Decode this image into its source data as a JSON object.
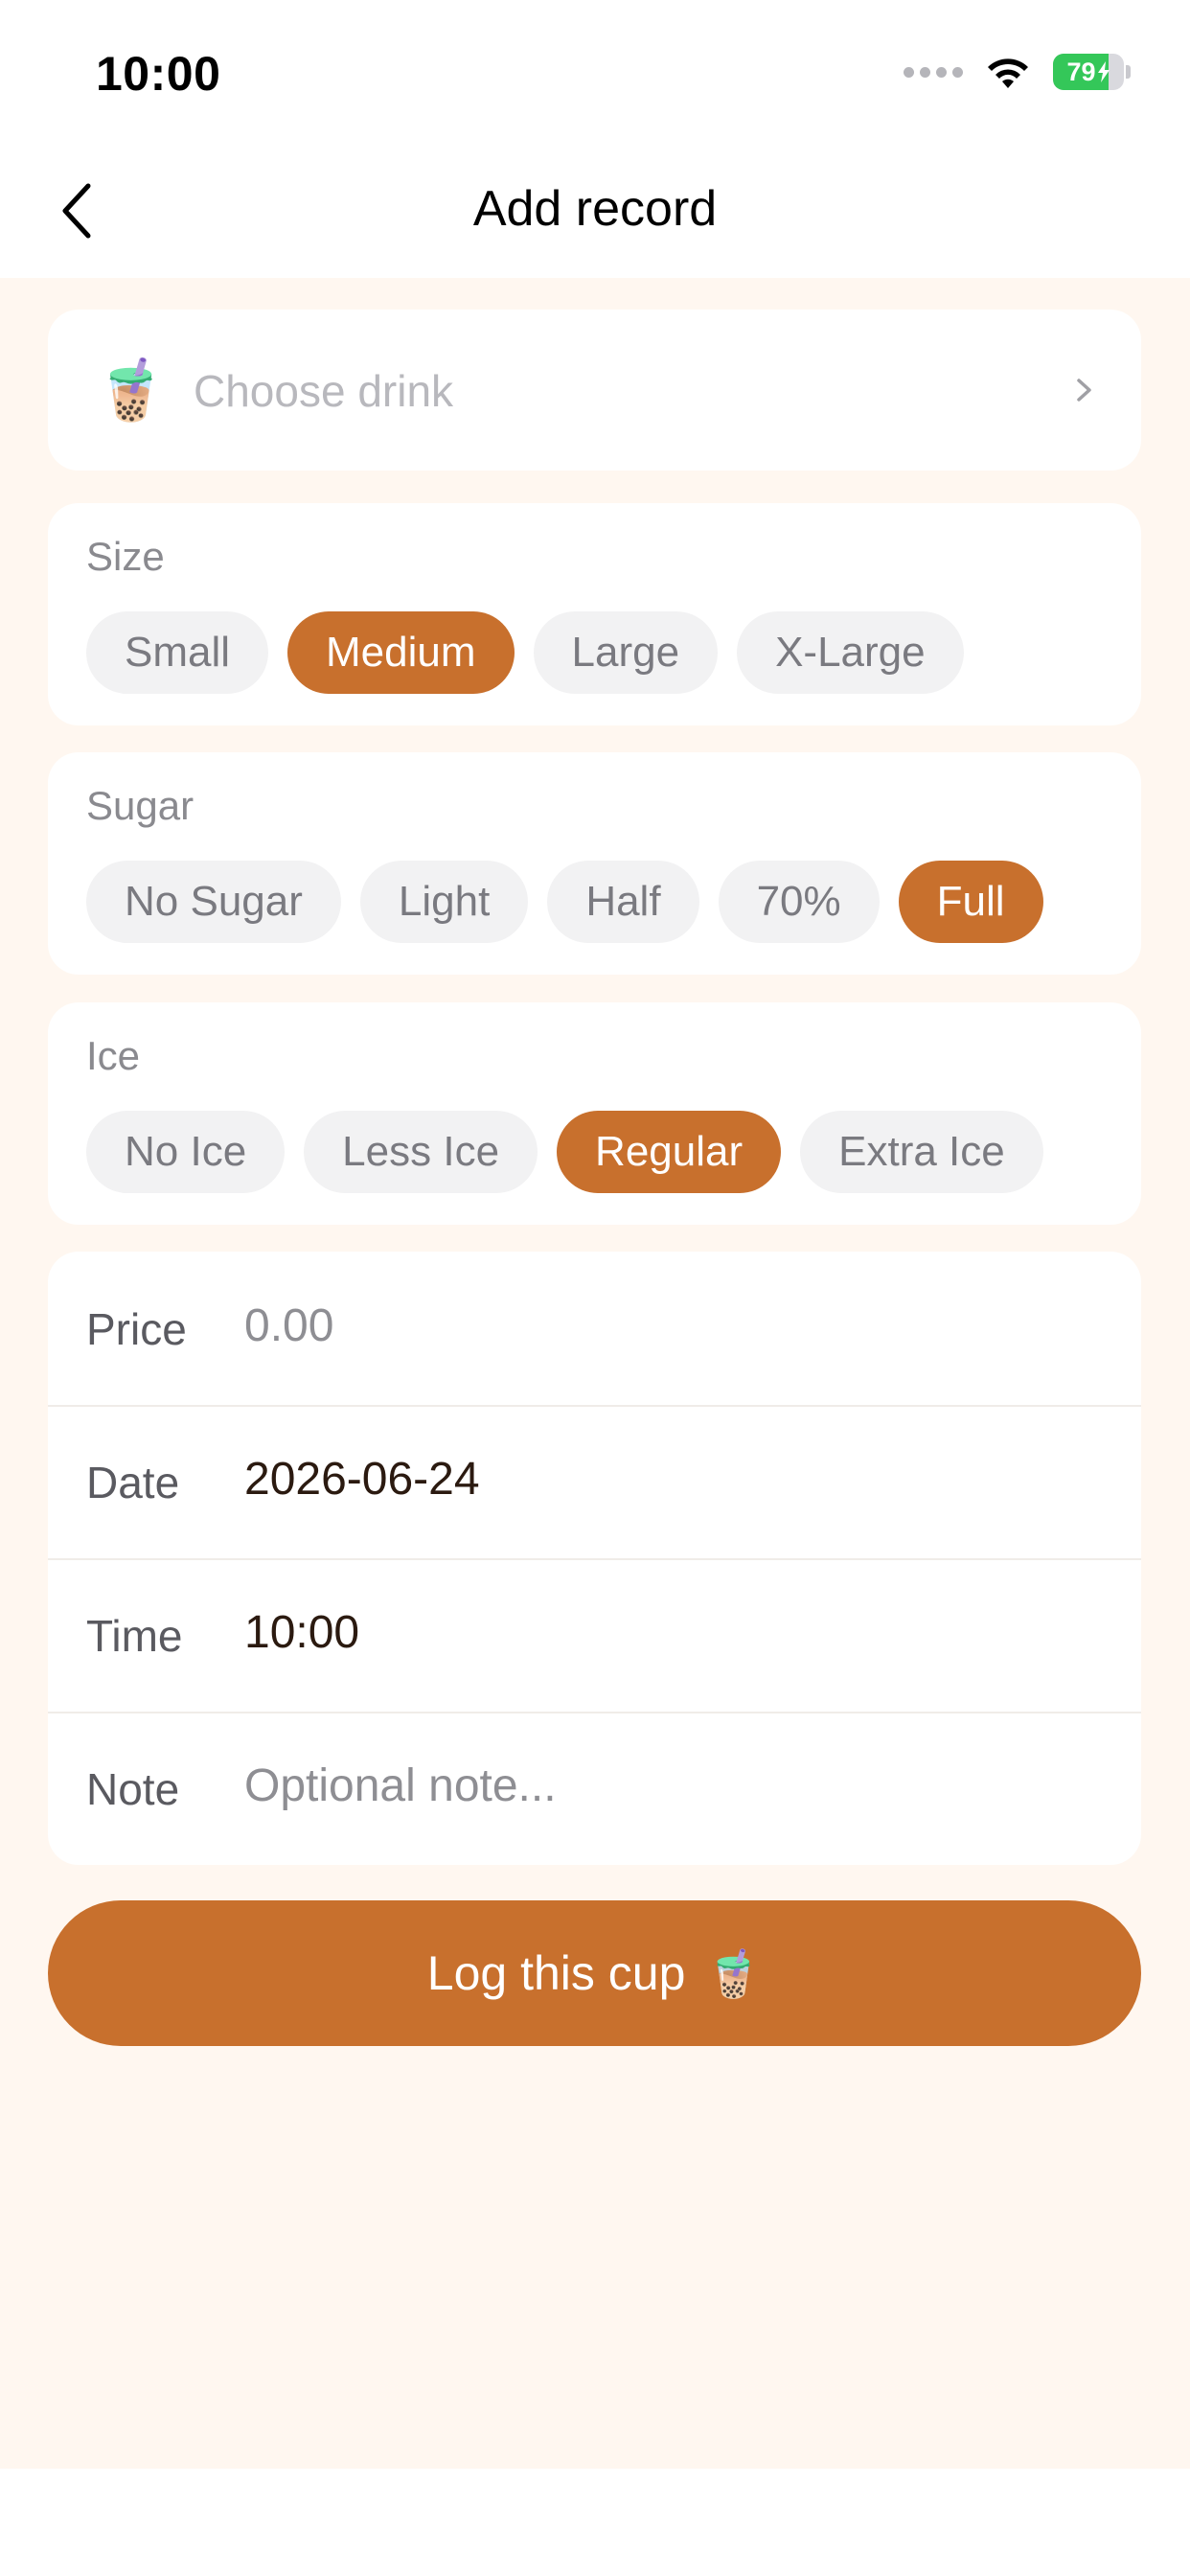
{
  "status_bar": {
    "time": "10:00",
    "battery_percent": 79,
    "battery_label": "79"
  },
  "nav": {
    "title": "Add record",
    "back_icon": "chevron-left-icon"
  },
  "drink": {
    "emoji": "🧋",
    "placeholder": "Choose drink",
    "chevron": "›"
  },
  "size": {
    "label": "Size",
    "options": [
      "Small",
      "Medium",
      "Large",
      "X-Large"
    ],
    "selected": "Medium"
  },
  "sugar": {
    "label": "Sugar",
    "options": [
      "No Sugar",
      "Light",
      "Half",
      "70%",
      "Full"
    ],
    "selected": "Full"
  },
  "ice": {
    "label": "Ice",
    "options": [
      "No Ice",
      "Less Ice",
      "Regular",
      "Extra Ice"
    ],
    "selected": "Regular"
  },
  "form": {
    "price": {
      "label": "Price",
      "value": "",
      "placeholder": "0.00"
    },
    "date": {
      "label": "Date",
      "value": "2026-06-24"
    },
    "time": {
      "label": "Time",
      "value": "10:00"
    },
    "note": {
      "label": "Note",
      "value": "",
      "placeholder": "Optional note..."
    }
  },
  "log_button": {
    "label": "Log this cup",
    "emoji": "🧋"
  },
  "colors": {
    "accent": "#c8702d",
    "background": "#fff7f0",
    "chip_bg": "#f2f2f3"
  }
}
